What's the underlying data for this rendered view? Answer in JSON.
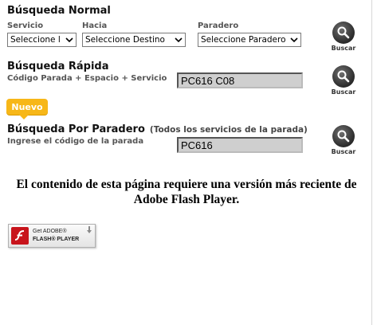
{
  "busqueda_normal": {
    "title": "Búsqueda Normal",
    "labels": {
      "servicio": "Servicio",
      "hacia": "Hacia",
      "paradero": "Paradero"
    },
    "selects": {
      "servicio": "Seleccione l",
      "destino": "Seleccione Destino",
      "paradero": "Seleccione Paradero"
    },
    "button_label": "Buscar"
  },
  "busqueda_rapida": {
    "title": "Búsqueda Rápida",
    "hint": "Código Parada + Espacio + Servicio",
    "input_value": "PC616 C08",
    "button_label": "Buscar"
  },
  "badge": {
    "label": "Nuevo",
    "color": "#f7b718"
  },
  "busqueda_paradero": {
    "title": "Búsqueda Por Paradero",
    "note": "(Todos los servicios de la parada)",
    "hint": "Ingrese el código de la parada",
    "input_value": "PC616",
    "button_label": "Buscar"
  },
  "flash": {
    "message_line1": "El contenido de esta página requiere una versión más reciente de",
    "message_line2": "Adobe Flash Player.",
    "badge_line1": "Get ADOBE®",
    "badge_line2": "FLASH® PLAYER",
    "brand_color": "#c8141c"
  }
}
